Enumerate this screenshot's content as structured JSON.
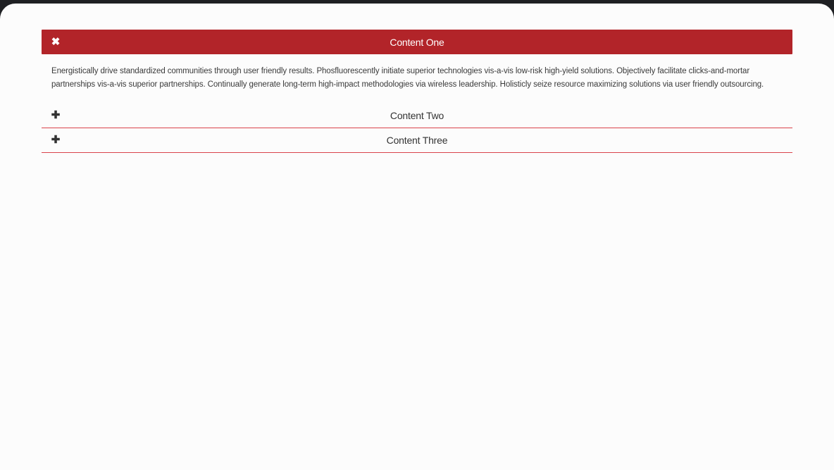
{
  "accordion": {
    "items": [
      {
        "title": "Content One",
        "icon": "close-icon",
        "expanded": true,
        "body": "Energistically drive standardized communities through user friendly results. Phosfluorescently initiate superior technologies vis-a-vis low-risk high-yield solutions. Objectively facilitate clicks-and-mortar partnerships vis-a-vis superior partnerships. Continually generate long-term high-impact methodologies via wireless leadership. Holisticly seize resource maximizing solutions via user friendly outsourcing."
      },
      {
        "title": "Content Two",
        "icon": "plus-icon",
        "expanded": false
      },
      {
        "title": "Content Three",
        "icon": "plus-icon",
        "expanded": false
      }
    ]
  },
  "colors": {
    "accent": "#b22429",
    "divider": "#d9434b",
    "background": "#fcfcfc",
    "frame": "#1f2023"
  }
}
